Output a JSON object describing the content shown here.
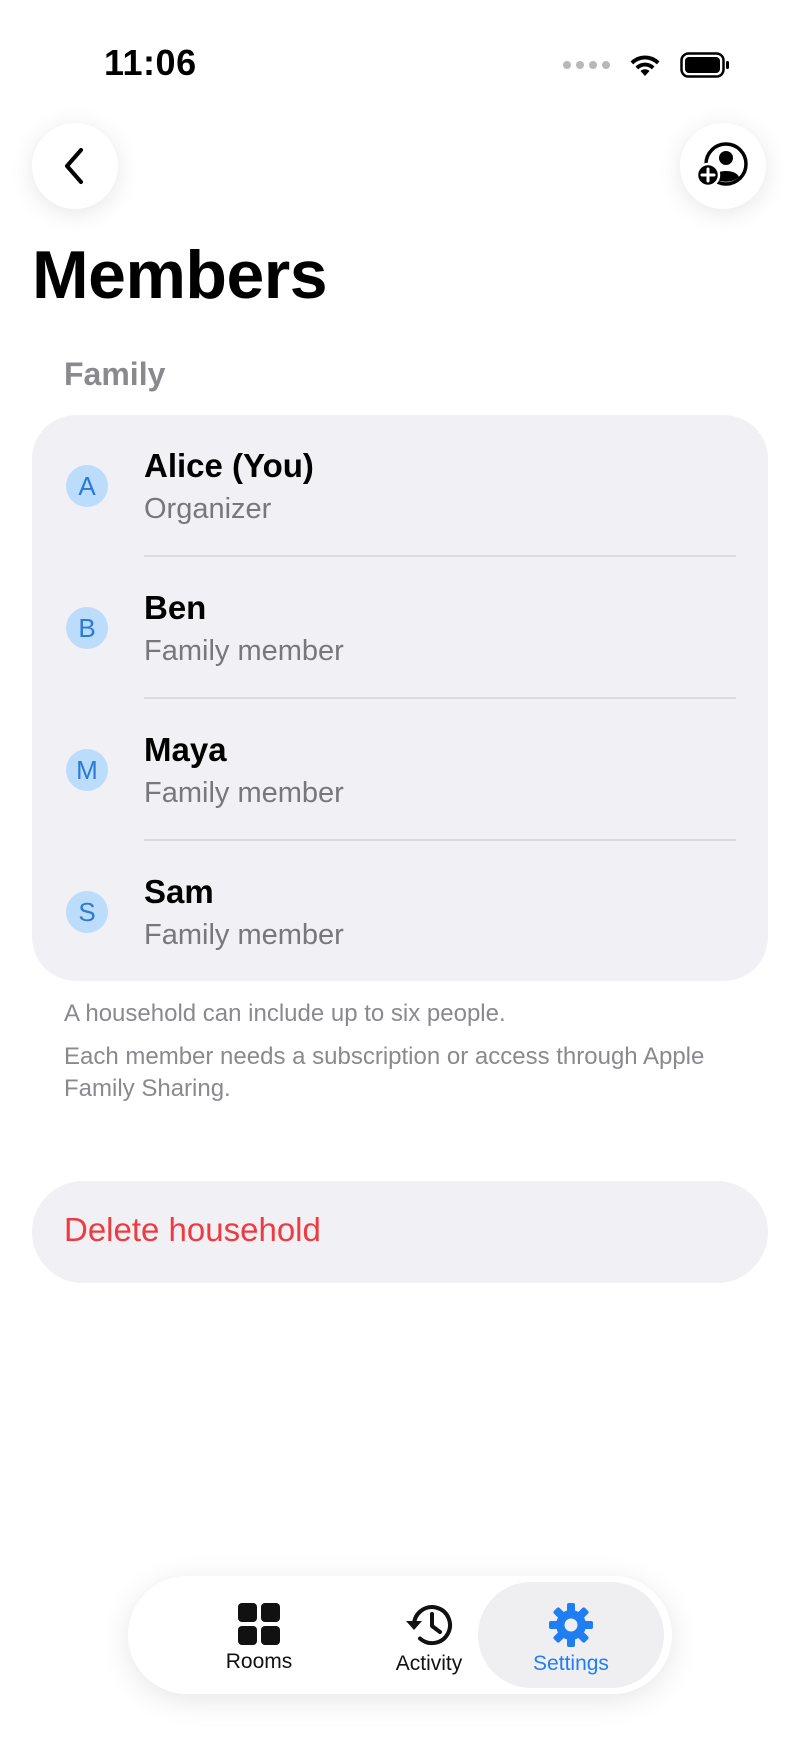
{
  "status_bar": {
    "time": "11:06"
  },
  "nav": {
    "back_icon": "chevron-left-icon",
    "add_member_icon": "person-add-icon"
  },
  "page": {
    "title": "Members"
  },
  "family_section": {
    "header": "Family",
    "members": [
      {
        "initial": "A",
        "name": "Alice (You)",
        "role": "Organizer"
      },
      {
        "initial": "B",
        "name": "Ben",
        "role": "Family member"
      },
      {
        "initial": "M",
        "name": "Maya",
        "role": "Family member"
      },
      {
        "initial": "S",
        "name": "Sam",
        "role": "Family member"
      }
    ],
    "footnote_1": "A household can include up to six people.",
    "footnote_2": "Each member needs a subscription or access through Apple Family Sharing."
  },
  "actions": {
    "delete_label": "Delete household"
  },
  "tab_bar": {
    "tabs": [
      {
        "label": "Rooms",
        "icon": "grid-icon"
      },
      {
        "label": "Activity",
        "icon": "history-icon"
      },
      {
        "label": "Settings",
        "icon": "gear-icon"
      }
    ],
    "selected": "Settings"
  },
  "colors": {
    "accent": "#1f7ef2",
    "destructive": "#ef3b3f",
    "avatar_bg": "#bcdcfb",
    "avatar_text": "#2a7bd8",
    "card_bg": "#f0f0f5",
    "secondary_text": "#8a8a8e"
  }
}
